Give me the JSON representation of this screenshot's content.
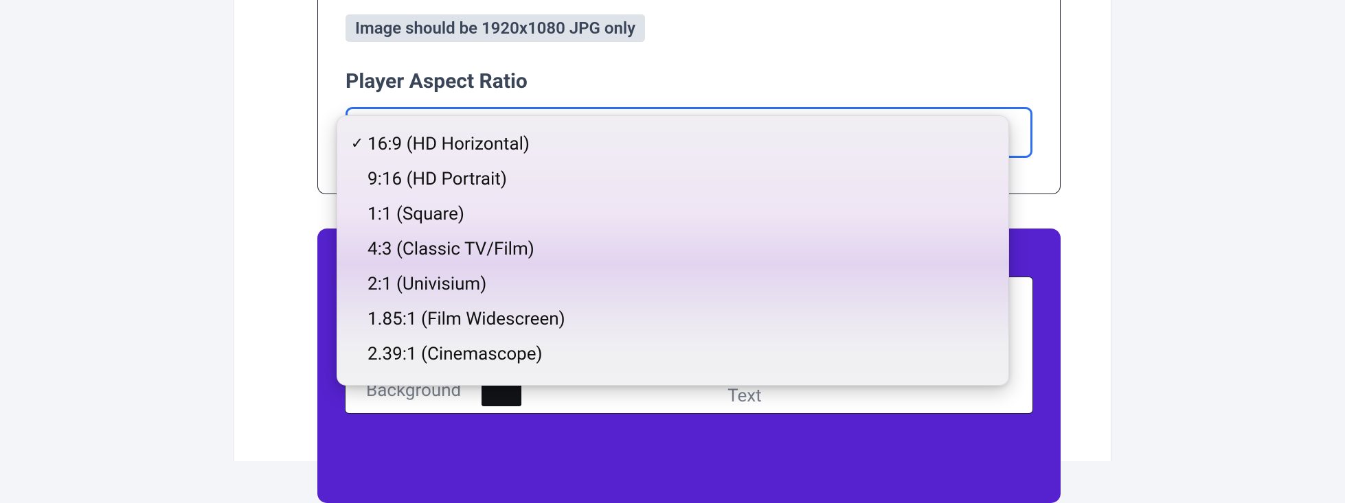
{
  "hint": "Image should be 1920x1080 JPG only",
  "field_label": "Player Aspect Ratio",
  "selected_index": 0,
  "options": [
    "16:9 (HD Horizontal)",
    "9:16 (HD Portrait)",
    "1:1 (Square)",
    "4:3 (Classic TV/Film)",
    "2:1 (Univisium)",
    "1.85:1 (Film Widescreen)",
    "2.39:1 (Cinemascope)"
  ],
  "lower": {
    "background_label": "Background",
    "text_label": "Text",
    "background_color": "#111317"
  }
}
